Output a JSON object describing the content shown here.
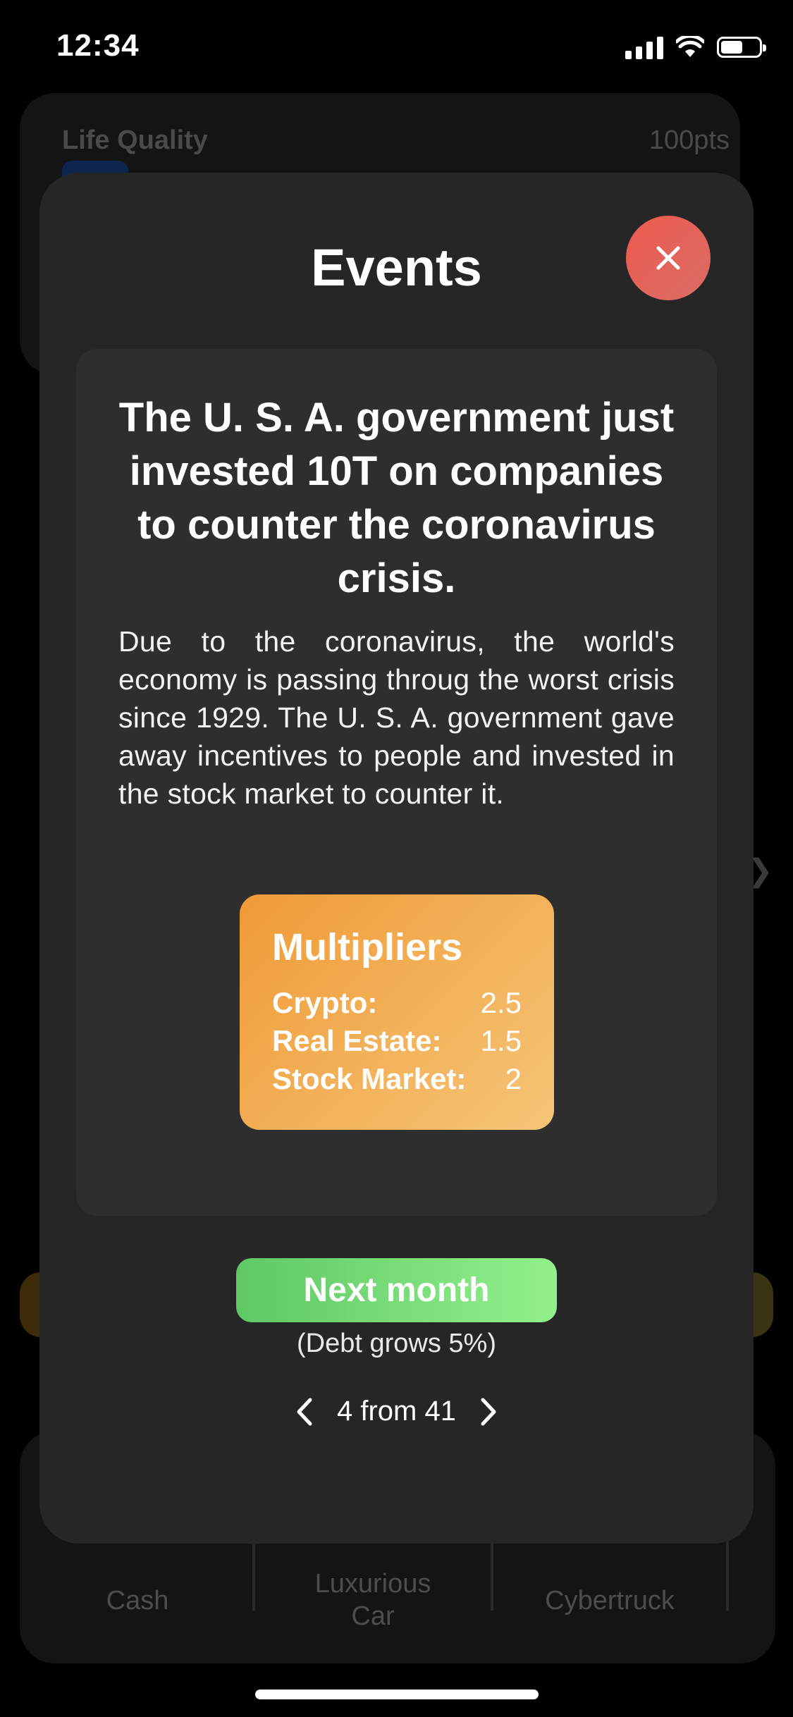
{
  "status_bar": {
    "time": "12:34"
  },
  "background": {
    "life_quality_label": "Life Quality",
    "life_quality_points": "100pts",
    "items": [
      {
        "label": "Cash"
      },
      {
        "label": "Luxurious\nCar"
      },
      {
        "label": "Cybertruck"
      }
    ]
  },
  "modal": {
    "title": "Events",
    "event": {
      "headline": "The U. S. A. government just invested 10T on companies to counter the coronavirus crisis.",
      "body": "Due to the coronavirus, the world's economy is passing throug the worst crisis since 1929. The U. S. A. government gave away incentives to people and invested in the stock market to counter it."
    },
    "multipliers": {
      "title": "Multipliers",
      "rows": [
        {
          "label": "Crypto:",
          "value": "2.5"
        },
        {
          "label": "Real Estate:",
          "value": "1.5"
        },
        {
          "label": "Stock Market:",
          "value": "2"
        }
      ]
    },
    "next_button_label": "Next month",
    "debt_note": "(Debt grows 5%)",
    "pager_text": "4 from 41"
  },
  "colors": {
    "close_button": "#e95b50",
    "multipliers_card": "#f2a944",
    "next_button": "#78dc78"
  }
}
